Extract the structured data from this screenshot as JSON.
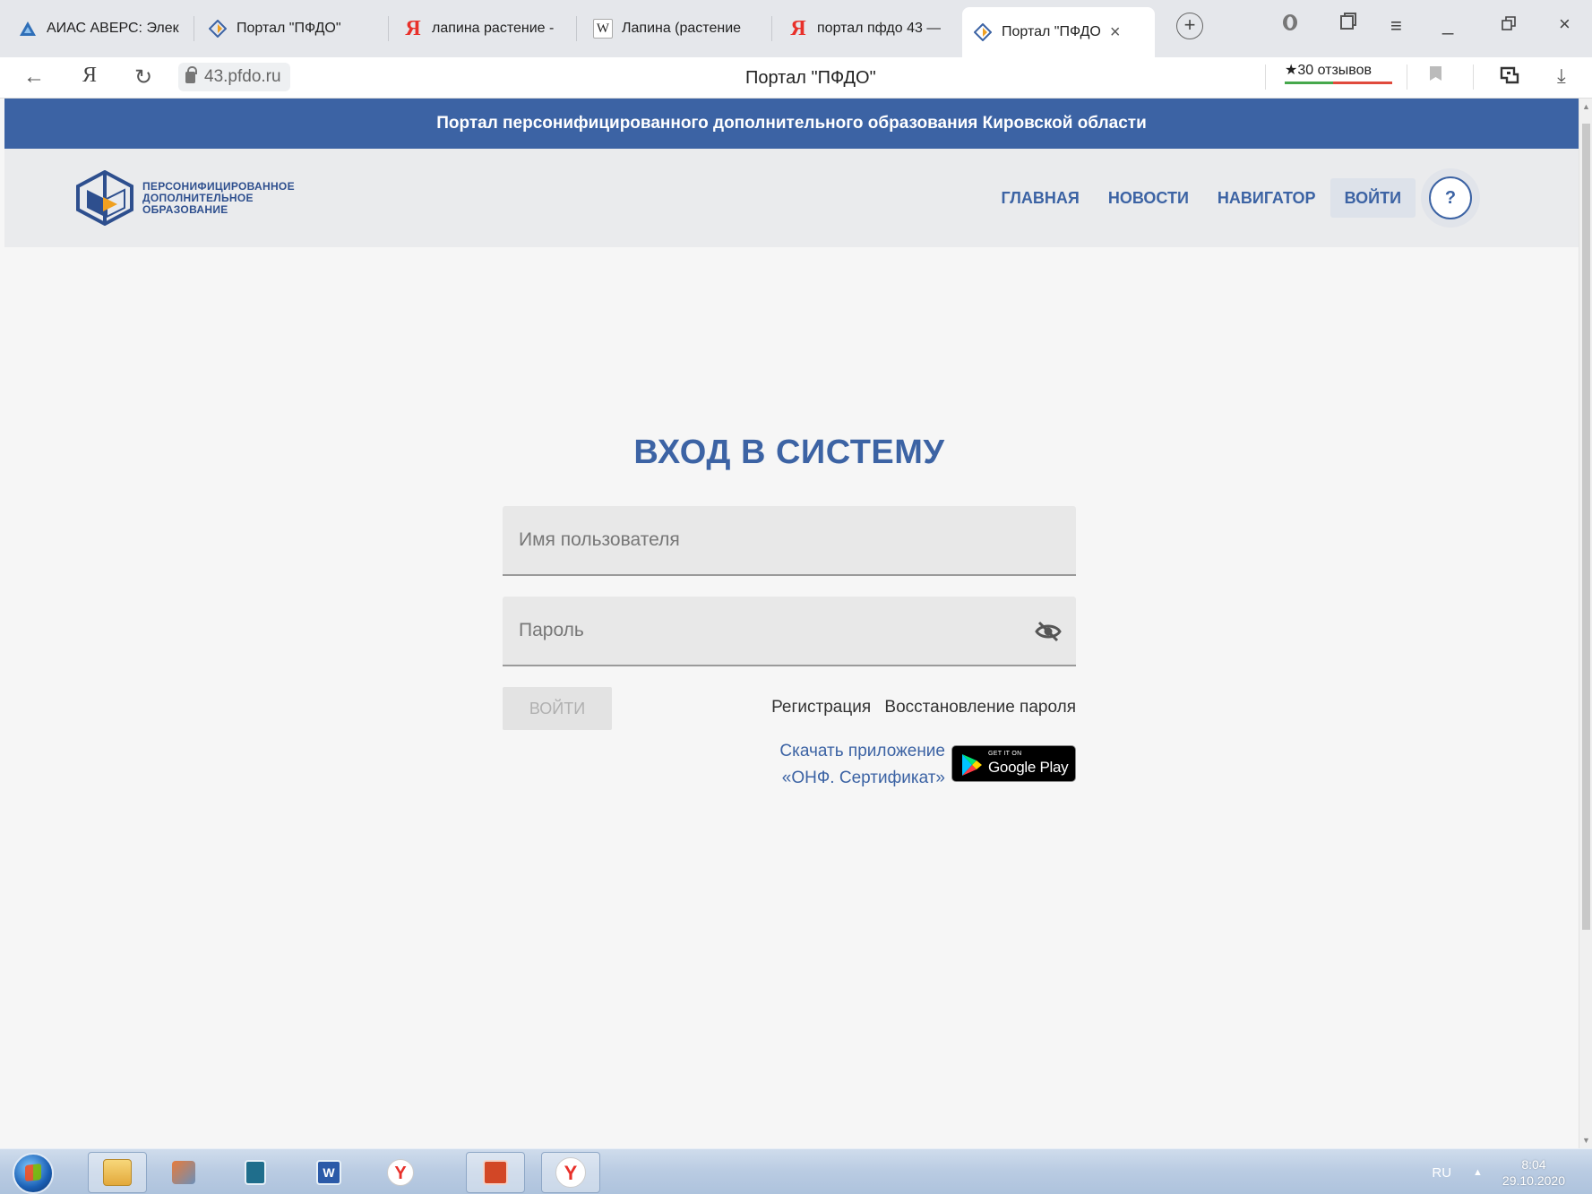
{
  "browser": {
    "tabs": [
      {
        "title": "АИАС АВЕРС: Элек",
        "icon": "avers-icon"
      },
      {
        "title": "Портал \"ПФДО\"",
        "icon": "pfdo-icon"
      },
      {
        "title": "лапина растение -",
        "icon": "yandex-icon"
      },
      {
        "title": "Лапина (растение",
        "icon": "wikipedia-icon"
      },
      {
        "title": "портал пфдо 43 —",
        "icon": "yandex-icon"
      },
      {
        "title": "Портал \"ПФДО",
        "icon": "pfdo-icon",
        "active": true
      }
    ],
    "url": "43.pfdo.ru",
    "page_title": "Портал \"ПФДО\"",
    "reviews": "★30 отзывов"
  },
  "banner": "Портал персонифицированного дополнительного образования Кировской области",
  "logo": {
    "line1": "ПЕРСОНИФИЦИРОВАННОЕ",
    "line2": "ДОПОЛНИТЕЛЬНОЕ",
    "line3": "ОБРАЗОВАНИЕ"
  },
  "nav": {
    "home": "ГЛАВНАЯ",
    "news": "НОВОСТИ",
    "navigator": "НАВИГАТОР",
    "login": "ВОЙТИ",
    "help": "?"
  },
  "login": {
    "title": "ВХОД В СИСТЕМУ",
    "username_placeholder": "Имя пользователя",
    "password_placeholder": "Пароль",
    "submit": "ВОЙТИ",
    "register": "Регистрация",
    "restore": "Восстановление пароля",
    "app_line1": "Скачать приложение",
    "app_line2": "«ОНФ. Сертификат»",
    "gplay_small": "GET IT ON",
    "gplay_big": "Google Play"
  },
  "taskbar": {
    "lang": "RU",
    "time": "8:04",
    "date": "29.10.2020"
  },
  "colors": {
    "brand": "#3c63a4",
    "page_bg": "#f6f6f6",
    "header_bg": "#eaebed"
  }
}
